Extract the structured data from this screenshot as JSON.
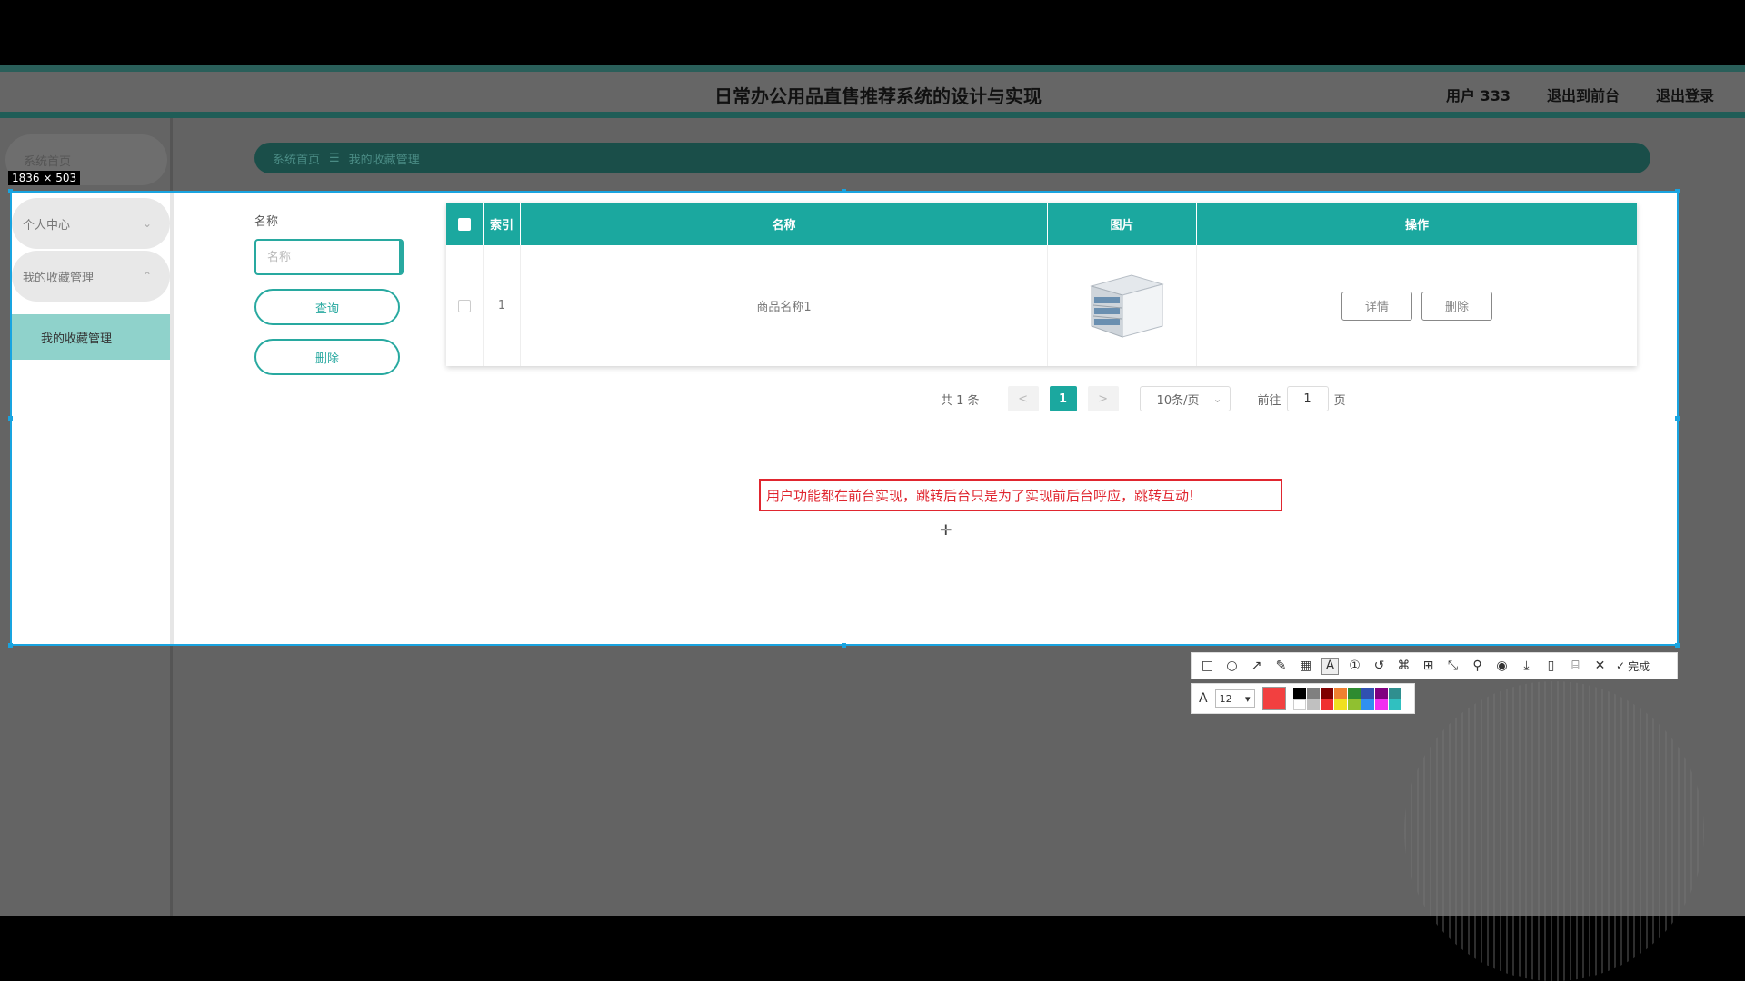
{
  "app": {
    "title": "日常办公用品直售推荐系统的设计与实现",
    "header_links": [
      "用户 333",
      "退出到前台",
      "退出登录"
    ],
    "breadcrumb": [
      "系统首页",
      "我的收藏管理"
    ],
    "breadcrumb_sep": "☰"
  },
  "capture": {
    "size_label": "1836 × 503"
  },
  "sidebar": {
    "items": [
      {
        "label": "系统首页"
      },
      {
        "label": "个人中心"
      },
      {
        "label": "我的收藏管理"
      }
    ],
    "sub_item": "我的收藏管理"
  },
  "filter": {
    "label": "名称",
    "placeholder": "名称",
    "query_label": "查询",
    "delete_label": "删除"
  },
  "table": {
    "columns": [
      "索引",
      "名称",
      "图片",
      "操作"
    ],
    "rows": [
      {
        "index": "1",
        "name": "商品名称1",
        "actions": [
          "详情",
          "删除"
        ]
      }
    ]
  },
  "pagination": {
    "total": "共 1 条",
    "prev": "<",
    "current": "1",
    "next": ">",
    "page_size": "10条/页",
    "goto_label": "前往",
    "goto_value": "1",
    "goto_suffix": "页"
  },
  "annotation": {
    "text": "用户功能都在前台实现，跳转后台只是为了实现前后台呼应，跳转互动!"
  },
  "toolbar": {
    "done_label": "完成",
    "font_size": "12",
    "current_color": "#f24040",
    "palette": [
      "#000000",
      "#808080",
      "#800000",
      "#f08030",
      "#2e8b30",
      "#3050b0",
      "#800080",
      "#2f8f8f",
      "#ffffff",
      "#c0c0c0",
      "#f03030",
      "#f0e020",
      "#90c030",
      "#3090f0",
      "#f030f0",
      "#30c0c0"
    ]
  },
  "colors": {
    "accent": "#1ba89f",
    "annotation": "#e0262f",
    "selection": "#19a4e0"
  }
}
